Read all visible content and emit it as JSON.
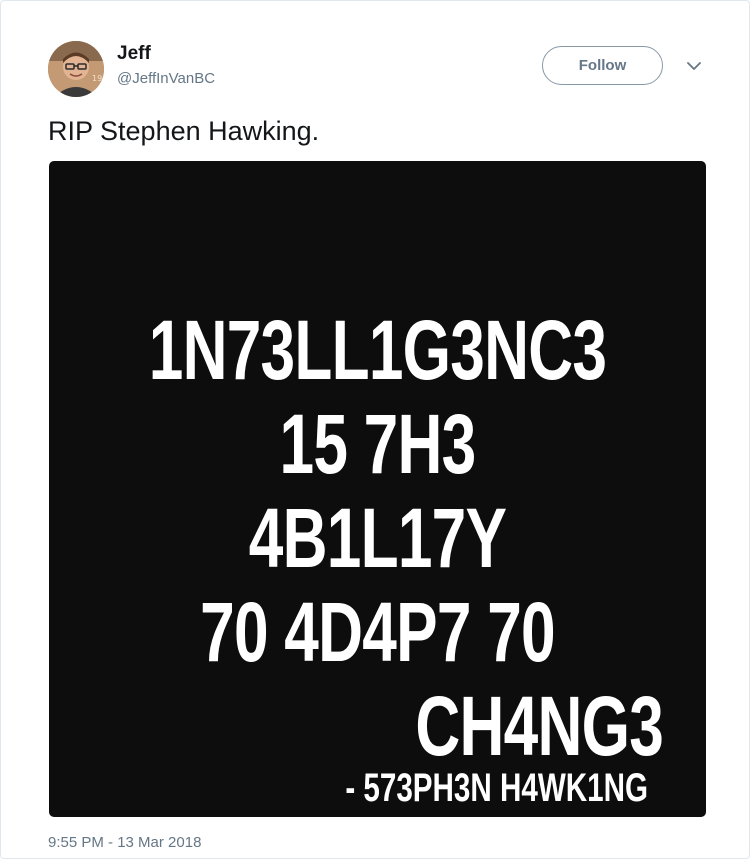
{
  "author": {
    "display_name": "Jeff",
    "screen_name": "@JeffInVanBC",
    "avatar_icon": "profile-photo"
  },
  "header": {
    "follow_label": "Follow",
    "caret_icon": "chevron-down-icon"
  },
  "tweet": {
    "text": "RIP Stephen Hawking.",
    "timestamp": "9:55 PM - 13 Mar 2018"
  },
  "media": {
    "background": "#0d0d0d",
    "lines": [
      "1N73LL1G3NC3",
      "15 7H3",
      "4B1L17Y",
      "70 4D4P7 70",
      "CH4NG3"
    ],
    "attribution": "- 573PH3N H4WK1NG"
  },
  "colors": {
    "text_primary": "#14171a",
    "text_secondary": "#657786",
    "border": "#e1e8ed"
  }
}
